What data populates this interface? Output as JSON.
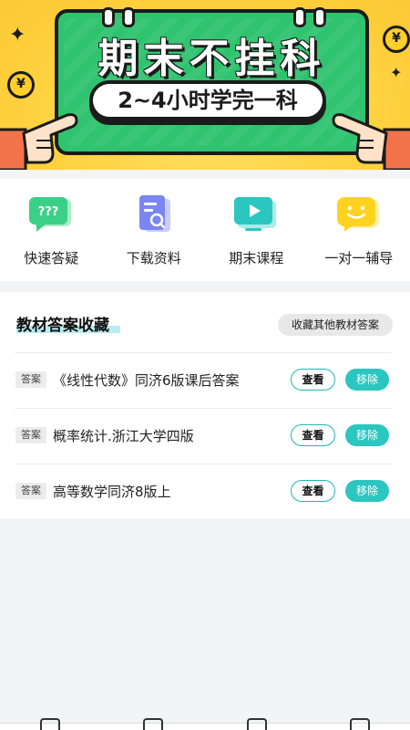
{
  "banner": {
    "title": "期末不挂科",
    "subtitle": "2~4小时学完一科",
    "coin_symbol": "¥"
  },
  "quick_nav": [
    {
      "label": "快速答疑",
      "icon": "question-chat-icon",
      "color": "#3ccf86"
    },
    {
      "label": "下载资料",
      "icon": "document-search-icon",
      "color": "#7b86f4"
    },
    {
      "label": "期末课程",
      "icon": "play-screen-icon",
      "color": "#2cc6c0"
    },
    {
      "label": "一对一辅导",
      "icon": "smile-chat-icon",
      "color": "#ffd21f"
    }
  ],
  "answers": {
    "title": "教材答案收藏",
    "more_label": "收藏其他教材答案",
    "items": [
      {
        "tag": "答案",
        "title": "《线性代数》同济6版课后答案",
        "view": "查看",
        "remove": "移除"
      },
      {
        "tag": "答案",
        "title": "概率统计.浙江大学四版",
        "view": "查看",
        "remove": "移除"
      },
      {
        "tag": "答案",
        "title": "高等数学同济8版上",
        "view": "查看",
        "remove": "移除"
      }
    ]
  },
  "colors": {
    "accent": "#2cc6c0",
    "banner_bg": "#ffd23f",
    "board_green": "#2fc36f"
  }
}
